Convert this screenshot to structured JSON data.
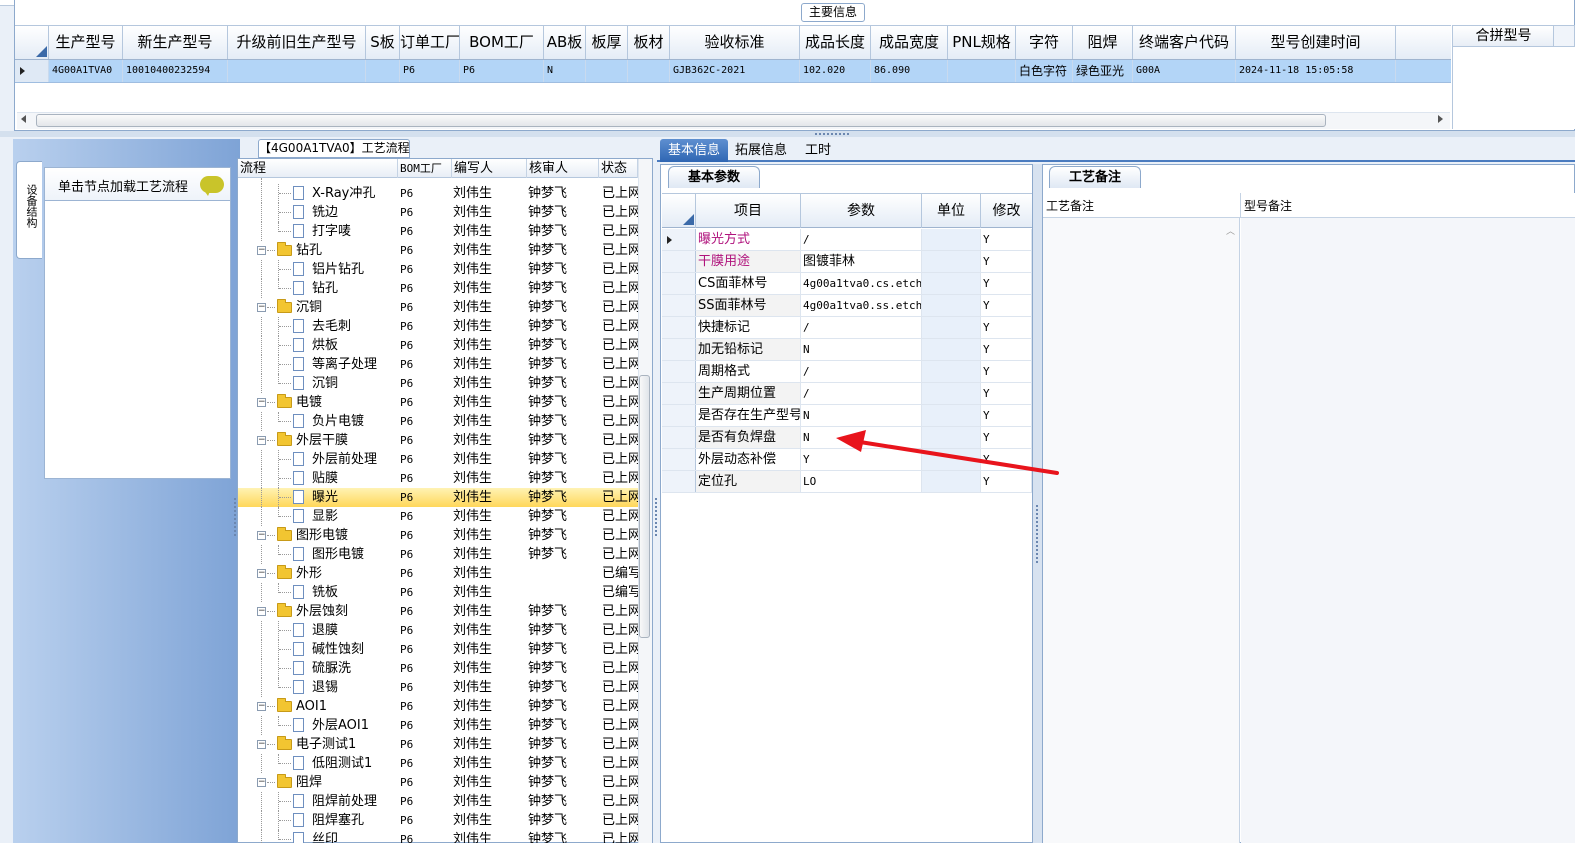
{
  "top": {
    "section_title": "主要信息",
    "columns": [
      "生产型号",
      "新生产型号",
      "升级前旧生产型号",
      "S板",
      "订单工厂",
      "BOM工厂",
      "AB板",
      "板厚",
      "板材",
      "验收标准",
      "成品长度",
      "成品宽度",
      "PNL规格",
      "字符",
      "阻焊",
      "终端客户代码",
      "型号创建时间"
    ],
    "merge_column": "合拼型号",
    "row": [
      "4G00A1TVA0",
      "10010400232594",
      "",
      "",
      "P6",
      "P6",
      "N",
      "",
      "",
      "GJB362C-2021",
      "102.020",
      "86.090",
      "",
      "白色字符",
      "绿色亚光",
      "G00A",
      "2024-11-18 15:05:58"
    ]
  },
  "left": {
    "vertical_tab": "设备结构",
    "hint": "单击节点加载工艺流程"
  },
  "process": {
    "tab_title": "【4G00A1TVA0】工艺流程",
    "columns": [
      "流程",
      "BOM工厂",
      "编写人",
      "核审人",
      "状态"
    ],
    "rows": [
      {
        "name": "X-Ray冲孔",
        "level": 2,
        "folder": false,
        "bom": "P6",
        "author": "刘伟生",
        "reviewer": "钟梦飞",
        "status": "已上网"
      },
      {
        "name": "铣边",
        "level": 2,
        "folder": false,
        "bom": "P6",
        "author": "刘伟生",
        "reviewer": "钟梦飞",
        "status": "已上网"
      },
      {
        "name": "打字唛",
        "level": 2,
        "folder": false,
        "bom": "P6",
        "author": "刘伟生",
        "reviewer": "钟梦飞",
        "status": "已上网"
      },
      {
        "name": "钻孔",
        "level": 1,
        "folder": true,
        "bom": "P6",
        "author": "刘伟生",
        "reviewer": "钟梦飞",
        "status": "已上网"
      },
      {
        "name": "铝片钻孔",
        "level": 2,
        "folder": false,
        "bom": "P6",
        "author": "刘伟生",
        "reviewer": "钟梦飞",
        "status": "已上网"
      },
      {
        "name": "钻孔",
        "level": 2,
        "folder": false,
        "bom": "P6",
        "author": "刘伟生",
        "reviewer": "钟梦飞",
        "status": "已上网"
      },
      {
        "name": "沉铜",
        "level": 1,
        "folder": true,
        "bom": "P6",
        "author": "刘伟生",
        "reviewer": "钟梦飞",
        "status": "已上网"
      },
      {
        "name": "去毛刺",
        "level": 2,
        "folder": false,
        "bom": "P6",
        "author": "刘伟生",
        "reviewer": "钟梦飞",
        "status": "已上网"
      },
      {
        "name": "烘板",
        "level": 2,
        "folder": false,
        "bom": "P6",
        "author": "刘伟生",
        "reviewer": "钟梦飞",
        "status": "已上网"
      },
      {
        "name": "等离子处理",
        "level": 2,
        "folder": false,
        "bom": "P6",
        "author": "刘伟生",
        "reviewer": "钟梦飞",
        "status": "已上网"
      },
      {
        "name": "沉铜",
        "level": 2,
        "folder": false,
        "bom": "P6",
        "author": "刘伟生",
        "reviewer": "钟梦飞",
        "status": "已上网"
      },
      {
        "name": "电镀",
        "level": 1,
        "folder": true,
        "bom": "P6",
        "author": "刘伟生",
        "reviewer": "钟梦飞",
        "status": "已上网"
      },
      {
        "name": "负片电镀",
        "level": 2,
        "folder": false,
        "bom": "P6",
        "author": "刘伟生",
        "reviewer": "钟梦飞",
        "status": "已上网"
      },
      {
        "name": "外层干膜",
        "level": 1,
        "folder": true,
        "bom": "P6",
        "author": "刘伟生",
        "reviewer": "钟梦飞",
        "status": "已上网"
      },
      {
        "name": "外层前处理",
        "level": 2,
        "folder": false,
        "bom": "P6",
        "author": "刘伟生",
        "reviewer": "钟梦飞",
        "status": "已上网"
      },
      {
        "name": "贴膜",
        "level": 2,
        "folder": false,
        "bom": "P6",
        "author": "刘伟生",
        "reviewer": "钟梦飞",
        "status": "已上网"
      },
      {
        "name": "曝光",
        "level": 2,
        "folder": false,
        "bom": "P6",
        "author": "刘伟生",
        "reviewer": "钟梦飞",
        "status": "已上网",
        "selected": true
      },
      {
        "name": "显影",
        "level": 2,
        "folder": false,
        "bom": "P6",
        "author": "刘伟生",
        "reviewer": "钟梦飞",
        "status": "已上网"
      },
      {
        "name": "图形电镀",
        "level": 1,
        "folder": true,
        "bom": "P6",
        "author": "刘伟生",
        "reviewer": "钟梦飞",
        "status": "已上网"
      },
      {
        "name": "图形电镀",
        "level": 2,
        "folder": false,
        "bom": "P6",
        "author": "刘伟生",
        "reviewer": "钟梦飞",
        "status": "已上网"
      },
      {
        "name": "外形",
        "level": 1,
        "folder": true,
        "bom": "P6",
        "author": "刘伟生",
        "reviewer": "",
        "status": "已编写"
      },
      {
        "name": "铣板",
        "level": 2,
        "folder": false,
        "bom": "P6",
        "author": "刘伟生",
        "reviewer": "",
        "status": "已编写"
      },
      {
        "name": "外层蚀刻",
        "level": 1,
        "folder": true,
        "bom": "P6",
        "author": "刘伟生",
        "reviewer": "钟梦飞",
        "status": "已上网"
      },
      {
        "name": "退膜",
        "level": 2,
        "folder": false,
        "bom": "P6",
        "author": "刘伟生",
        "reviewer": "钟梦飞",
        "status": "已上网"
      },
      {
        "name": "碱性蚀刻",
        "level": 2,
        "folder": false,
        "bom": "P6",
        "author": "刘伟生",
        "reviewer": "钟梦飞",
        "status": "已上网"
      },
      {
        "name": "硫脲洗",
        "level": 2,
        "folder": false,
        "bom": "P6",
        "author": "刘伟生",
        "reviewer": "钟梦飞",
        "status": "已上网"
      },
      {
        "name": "退锡",
        "level": 2,
        "folder": false,
        "bom": "P6",
        "author": "刘伟生",
        "reviewer": "钟梦飞",
        "status": "已上网"
      },
      {
        "name": "AOI1",
        "level": 1,
        "folder": true,
        "bom": "P6",
        "author": "刘伟生",
        "reviewer": "钟梦飞",
        "status": "已上网"
      },
      {
        "name": "外层AOI1",
        "level": 2,
        "folder": false,
        "bom": "P6",
        "author": "刘伟生",
        "reviewer": "钟梦飞",
        "status": "已上网"
      },
      {
        "name": "电子测试1",
        "level": 1,
        "folder": true,
        "bom": "P6",
        "author": "刘伟生",
        "reviewer": "钟梦飞",
        "status": "已上网"
      },
      {
        "name": "低阻测试1",
        "level": 2,
        "folder": false,
        "bom": "P6",
        "author": "刘伟生",
        "reviewer": "钟梦飞",
        "status": "已上网"
      },
      {
        "name": "阻焊",
        "level": 1,
        "folder": true,
        "bom": "P6",
        "author": "刘伟生",
        "reviewer": "钟梦飞",
        "status": "已上网"
      },
      {
        "name": "阻焊前处理",
        "level": 2,
        "folder": false,
        "bom": "P6",
        "author": "刘伟生",
        "reviewer": "钟梦飞",
        "status": "已上网"
      },
      {
        "name": "阻焊塞孔",
        "level": 2,
        "folder": false,
        "bom": "P6",
        "author": "刘伟生",
        "reviewer": "钟梦飞",
        "status": "已上网"
      },
      {
        "name": "丝印",
        "level": 2,
        "folder": false,
        "bom": "P6",
        "author": "刘伟生",
        "reviewer": "钟梦飞",
        "status": "已上网"
      }
    ]
  },
  "detail": {
    "tabs": [
      "基本信息",
      "拓展信息",
      "工时"
    ],
    "param_tab": "基本参数",
    "param_columns": [
      "项目",
      "参数",
      "单位",
      "修改"
    ],
    "params": [
      {
        "item": "曝光方式",
        "value": "/",
        "unit": "",
        "edit": "Y",
        "highlight": true
      },
      {
        "item": "干膜用途",
        "value": "图镀菲林",
        "unit": "",
        "edit": "Y",
        "highlight": true
      },
      {
        "item": "CS面菲林号",
        "value": "4g00a1tva0.cs.etch",
        "unit": "",
        "edit": "Y"
      },
      {
        "item": "SS面菲林号",
        "value": "4g00a1tva0.ss.etch",
        "unit": "",
        "edit": "Y"
      },
      {
        "item": "快捷标记",
        "value": "/",
        "unit": "",
        "edit": "Y"
      },
      {
        "item": "加无铅标记",
        "value": "N",
        "unit": "",
        "edit": "Y"
      },
      {
        "item": "周期格式",
        "value": "/",
        "unit": "",
        "edit": "Y"
      },
      {
        "item": "生产周期位置",
        "value": "/",
        "unit": "",
        "edit": "Y"
      },
      {
        "item": "是否存在生产型号",
        "value": "N",
        "unit": "",
        "edit": "Y"
      },
      {
        "item": "是否有负焊盘",
        "value": "N",
        "unit": "",
        "edit": "Y"
      },
      {
        "item": "外层动态补偿",
        "value": "Y",
        "unit": "",
        "edit": "Y"
      },
      {
        "item": "定位孔",
        "value": "LO",
        "unit": "",
        "edit": "Y"
      }
    ],
    "notes_tab": "工艺备注",
    "notes_columns": [
      "工艺备注",
      "型号备注"
    ]
  },
  "colors": {
    "selected_row": "#b3d5f7",
    "highlight_text": "#b0127c",
    "arrow": "#e8141c",
    "tab_active": "#2f66b3"
  }
}
